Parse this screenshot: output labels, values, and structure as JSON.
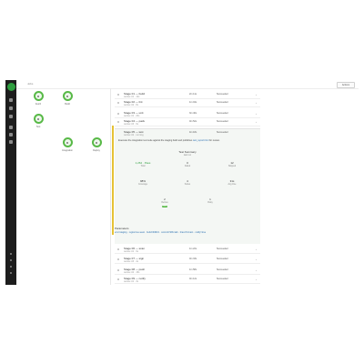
{
  "app": {
    "crumb": "Jobs",
    "top_button": "Actions"
  },
  "sidebar": {
    "icons": [
      "logo",
      "grid-icon",
      "user-icon",
      "settings-icon",
      "branch-icon",
      "list-icon",
      "alert-icon",
      "dot-icon",
      "dot-icon",
      "dot-icon",
      "dot-icon"
    ]
  },
  "graph": {
    "nodes": [
      {
        "label": "Fetch"
      },
      {
        "label": "Build"
      },
      {
        "label": "Test"
      },
      {
        "label": "Integration"
      },
      {
        "label": "Deploy"
      }
    ]
  },
  "rows_top": [
    {
      "title": "Stage 01 — build",
      "sub": "worker-01 · 12s",
      "c1": "2m 11s",
      "c2": "Succeeded"
    },
    {
      "title": "Stage 02 — lint",
      "sub": "worker-02 · 8s",
      "c1": "1m 04s",
      "c2": "Succeeded"
    },
    {
      "title": "Stage 03 — unit",
      "sub": "worker-01 · 20s",
      "c1": "3m 40s",
      "c2": "Succeeded"
    },
    {
      "title": "Stage 04 — pack",
      "sub": "worker-03 · 6s",
      "c1": "0m 52s",
      "c2": "Succeeded"
    }
  ],
  "detail": {
    "title": "Stage 05 — test",
    "sub": "worker-02 · running",
    "c1": "4m 18s",
    "c2": "Succeeded",
    "desc_text": "Executes the integration test suite against the staging build and publishes",
    "desc_link": "test_report.html",
    "desc_tail": "for review.",
    "section_title": "Test Summary",
    "section_sub": "last run",
    "stats": [
      {
        "value": "1,264 · Pass",
        "label": "Total",
        "green": true
      },
      {
        "value": "0",
        "label": "Failed",
        "green": false
      },
      {
        "value": "12",
        "label": "Skipped",
        "green": false
      },
      {
        "value": "98%",
        "label": "Coverage",
        "green": false
      },
      {
        "value": "4",
        "label": "Suites",
        "green": false
      },
      {
        "value": "31s",
        "label": "Avg time",
        "green": false
      },
      {
        "value": "2",
        "label": "Retries",
        "green": false
      },
      {
        "value": "1",
        "label": "Flaky",
        "green": false
      }
    ],
    "badge": "OK"
  },
  "params": {
    "title": "Parameters",
    "text": "env=staging · region=eu-west · build=#4821 · commit=9f3c1ab · branch=main · notify=true"
  },
  "rows_bottom": [
    {
      "title": "Stage 06 — scan",
      "sub": "worker-01 · 9s",
      "c1": "1m 22s",
      "c2": "Succeeded"
    },
    {
      "title": "Stage 07 — sign",
      "sub": "worker-03 · 4s",
      "c1": "0m 33s",
      "c2": "Succeeded"
    },
    {
      "title": "Stage 08 — push",
      "sub": "worker-02 · 15s",
      "c1": "1m 58s",
      "c2": "Succeeded"
    },
    {
      "title": "Stage 09 — notify",
      "sub": "worker-01 · 3s",
      "c1": "0m 12s",
      "c2": "Succeeded"
    }
  ]
}
